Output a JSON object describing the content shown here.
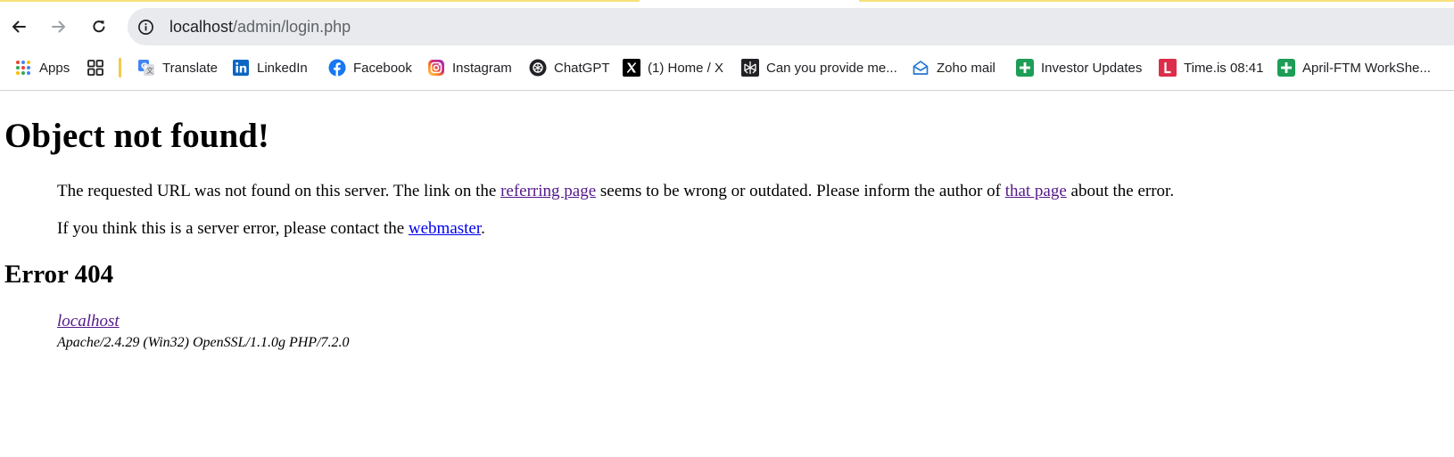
{
  "browser": {
    "url_host": "localhost",
    "url_path": "/admin/login.php",
    "bookmarks": [
      {
        "label": "Apps",
        "icon": "apps-grid-icon"
      },
      {
        "label": "",
        "icon": "tab-groups-icon"
      },
      {
        "label": "Translate",
        "icon": "google-translate-icon"
      },
      {
        "label": "LinkedIn",
        "icon": "linkedin-icon"
      },
      {
        "label": "Facebook",
        "icon": "facebook-icon"
      },
      {
        "label": "Instagram",
        "icon": "instagram-icon"
      },
      {
        "label": "ChatGPT",
        "icon": "chatgpt-icon"
      },
      {
        "label": "(1) Home / X",
        "icon": "x-icon"
      },
      {
        "label": "Can you provide me...",
        "icon": "perplexity-icon"
      },
      {
        "label": "Zoho mail",
        "icon": "zoho-mail-icon"
      },
      {
        "label": "Investor Updates",
        "icon": "google-sheets-icon"
      },
      {
        "label": "Time.is 08:41",
        "icon": "time-is-icon"
      },
      {
        "label": "April-FTM WorkShe...",
        "icon": "google-sheets-icon"
      }
    ]
  },
  "page": {
    "title": "Object not found!",
    "p1_before": "The requested URL was not found on this server. The link on the ",
    "p1_link1": "referring page",
    "p1_mid": " seems to be wrong or outdated. Please inform the author of ",
    "p1_link2": "that page",
    "p1_after": " about the error.",
    "p2_before": "If you think this is a server error, please contact the ",
    "p2_link": "webmaster",
    "p2_after": ".",
    "error_heading": "Error 404",
    "address_host": "localhost",
    "address_software": "Apache/2.4.29 (Win32) OpenSSL/1.1.0g PHP/7.2.0"
  },
  "colors": {
    "visited_link": "#551a8b",
    "unvisited_link": "#0000ee",
    "omnibox_bg": "#e8eaed"
  }
}
